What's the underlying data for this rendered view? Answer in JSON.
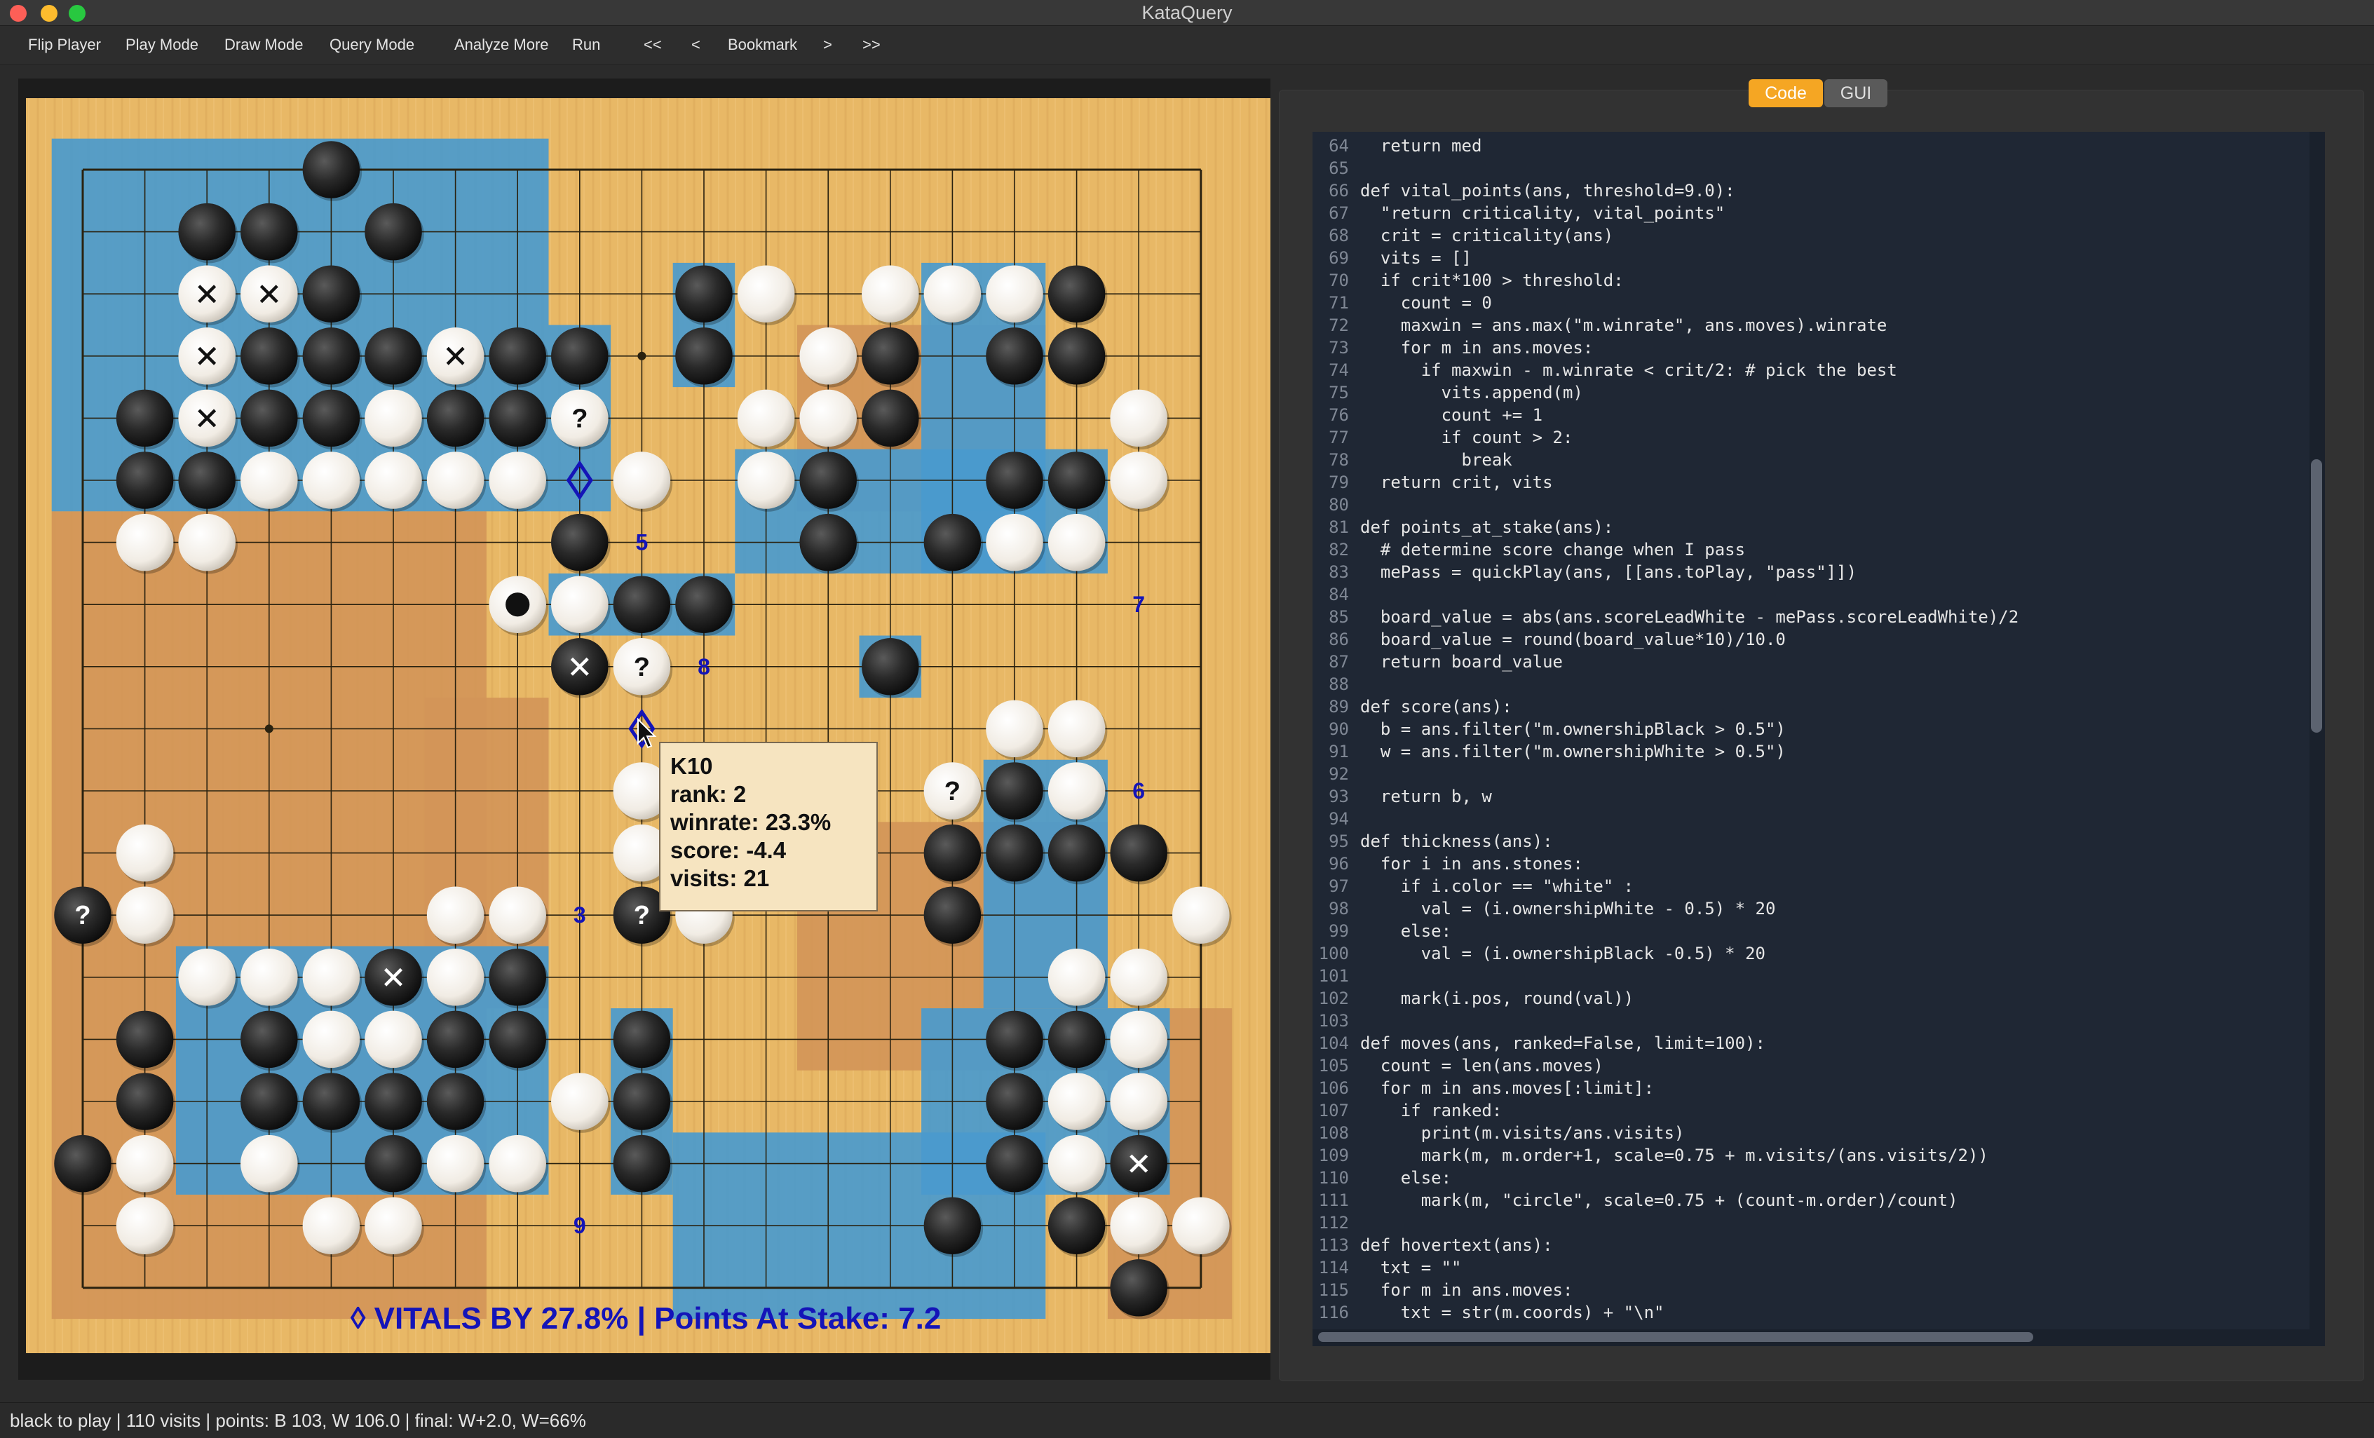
{
  "window": {
    "title": "KataQuery",
    "buttons": [
      "close",
      "minimize",
      "zoom"
    ],
    "colors": {
      "close": "#fe5f57",
      "minimize": "#febc2e",
      "zoom": "#28c840"
    }
  },
  "toolbar": {
    "items": [
      "Flip Player",
      "Play Mode",
      "Draw Mode",
      "Query Mode",
      "Analyze More",
      "Run",
      "<<",
      "<",
      "Bookmark",
      ">",
      ">>"
    ]
  },
  "board": {
    "size": 19,
    "columns": "ABCDEFGHJKLMNOPQRST",
    "colors": {
      "wood": "#e8b866",
      "blue_territory": "#4a9acd",
      "orange_territory": "#d39558",
      "marker": "#1414b8"
    },
    "blue_regions": [
      {
        "cols": [
          0,
          7
        ],
        "rows": [
          0,
          2
        ]
      },
      {
        "cols": [
          0,
          8
        ],
        "rows": [
          3,
          5
        ]
      },
      {
        "cols": [
          10,
          10
        ],
        "rows": [
          2,
          3
        ]
      },
      {
        "cols": [
          14,
          15
        ],
        "rows": [
          2,
          6
        ]
      },
      {
        "cols": [
          11,
          16
        ],
        "rows": [
          5,
          6
        ]
      },
      {
        "cols": [
          15,
          16
        ],
        "rows": [
          10,
          13
        ]
      },
      {
        "cols": [
          2,
          7
        ],
        "rows": [
          13,
          16
        ]
      },
      {
        "cols": [
          9,
          9
        ],
        "rows": [
          14,
          16
        ]
      },
      {
        "cols": [
          10,
          15
        ],
        "rows": [
          16,
          18
        ]
      },
      {
        "cols": [
          14,
          17
        ],
        "rows": [
          14,
          16
        ]
      },
      {
        "cols": [
          8,
          10
        ],
        "rows": [
          7,
          7
        ]
      },
      {
        "cols": [
          13,
          13
        ],
        "rows": [
          8,
          8
        ]
      }
    ],
    "orange_regions": [
      {
        "cols": [
          0,
          6
        ],
        "rows": [
          6,
          18
        ]
      },
      {
        "cols": [
          6,
          7
        ],
        "rows": [
          9,
          13
        ]
      },
      {
        "cols": [
          12,
          16
        ],
        "rows": [
          11,
          14
        ]
      },
      {
        "cols": [
          17,
          18
        ],
        "rows": [
          14,
          18
        ]
      },
      {
        "cols": [
          12,
          15
        ],
        "rows": [
          3,
          5
        ]
      }
    ],
    "stones": [
      {
        "c": 4,
        "r": 0,
        "color": "B"
      },
      {
        "c": 2,
        "r": 1,
        "color": "B"
      },
      {
        "c": 3,
        "r": 1,
        "color": "B"
      },
      {
        "c": 5,
        "r": 1,
        "color": "B"
      },
      {
        "c": 2,
        "r": 2,
        "color": "W",
        "mark": "x"
      },
      {
        "c": 3,
        "r": 2,
        "color": "W",
        "mark": "x"
      },
      {
        "c": 4,
        "r": 2,
        "color": "B"
      },
      {
        "c": 10,
        "r": 2,
        "color": "B"
      },
      {
        "c": 11,
        "r": 2,
        "color": "W"
      },
      {
        "c": 13,
        "r": 2,
        "color": "W"
      },
      {
        "c": 14,
        "r": 2,
        "color": "W"
      },
      {
        "c": 15,
        "r": 2,
        "color": "W"
      },
      {
        "c": 16,
        "r": 2,
        "color": "B"
      },
      {
        "c": 2,
        "r": 3,
        "color": "W",
        "mark": "x"
      },
      {
        "c": 3,
        "r": 3,
        "color": "B"
      },
      {
        "c": 4,
        "r": 3,
        "color": "B"
      },
      {
        "c": 5,
        "r": 3,
        "color": "B"
      },
      {
        "c": 6,
        "r": 3,
        "color": "W",
        "mark": "x"
      },
      {
        "c": 7,
        "r": 3,
        "color": "B"
      },
      {
        "c": 8,
        "r": 3,
        "color": "B"
      },
      {
        "c": 10,
        "r": 3,
        "color": "B"
      },
      {
        "c": 12,
        "r": 3,
        "color": "W"
      },
      {
        "c": 13,
        "r": 3,
        "color": "B"
      },
      {
        "c": 15,
        "r": 3,
        "color": "B"
      },
      {
        "c": 16,
        "r": 3,
        "color": "B"
      },
      {
        "c": 1,
        "r": 4,
        "color": "B"
      },
      {
        "c": 2,
        "r": 4,
        "color": "W",
        "mark": "x"
      },
      {
        "c": 3,
        "r": 4,
        "color": "B"
      },
      {
        "c": 4,
        "r": 4,
        "color": "B"
      },
      {
        "c": 5,
        "r": 4,
        "color": "W"
      },
      {
        "c": 6,
        "r": 4,
        "color": "B"
      },
      {
        "c": 7,
        "r": 4,
        "color": "B"
      },
      {
        "c": 8,
        "r": 4,
        "color": "W",
        "mark": "?"
      },
      {
        "c": 11,
        "r": 4,
        "color": "W"
      },
      {
        "c": 12,
        "r": 4,
        "color": "W"
      },
      {
        "c": 13,
        "r": 4,
        "color": "B"
      },
      {
        "c": 17,
        "r": 4,
        "color": "W"
      },
      {
        "c": 1,
        "r": 5,
        "color": "B"
      },
      {
        "c": 2,
        "r": 5,
        "color": "B"
      },
      {
        "c": 3,
        "r": 5,
        "color": "W"
      },
      {
        "c": 4,
        "r": 5,
        "color": "W"
      },
      {
        "c": 5,
        "r": 5,
        "color": "W"
      },
      {
        "c": 6,
        "r": 5,
        "color": "W"
      },
      {
        "c": 7,
        "r": 5,
        "color": "W"
      },
      {
        "c": 9,
        "r": 5,
        "color": "W"
      },
      {
        "c": 11,
        "r": 5,
        "color": "W"
      },
      {
        "c": 12,
        "r": 5,
        "color": "B"
      },
      {
        "c": 15,
        "r": 5,
        "color": "B"
      },
      {
        "c": 16,
        "r": 5,
        "color": "B"
      },
      {
        "c": 17,
        "r": 5,
        "color": "W"
      },
      {
        "c": 1,
        "r": 6,
        "color": "W"
      },
      {
        "c": 2,
        "r": 6,
        "color": "W"
      },
      {
        "c": 8,
        "r": 6,
        "color": "B"
      },
      {
        "c": 12,
        "r": 6,
        "color": "B"
      },
      {
        "c": 14,
        "r": 6,
        "color": "B"
      },
      {
        "c": 15,
        "r": 6,
        "color": "W"
      },
      {
        "c": 16,
        "r": 6,
        "color": "W"
      },
      {
        "c": 7,
        "r": 7,
        "color": "W",
        "mark": "dot"
      },
      {
        "c": 8,
        "r": 7,
        "color": "W"
      },
      {
        "c": 9,
        "r": 7,
        "color": "B"
      },
      {
        "c": 10,
        "r": 7,
        "color": "B"
      },
      {
        "c": 8,
        "r": 8,
        "color": "B",
        "mark": "x"
      },
      {
        "c": 9,
        "r": 8,
        "color": "W",
        "mark": "?"
      },
      {
        "c": 13,
        "r": 8,
        "color": "B"
      },
      {
        "c": 15,
        "r": 9,
        "color": "W"
      },
      {
        "c": 16,
        "r": 9,
        "color": "W"
      },
      {
        "c": 9,
        "r": 10,
        "color": "W"
      },
      {
        "c": 14,
        "r": 10,
        "color": "W",
        "mark": "?"
      },
      {
        "c": 15,
        "r": 10,
        "color": "B"
      },
      {
        "c": 16,
        "r": 10,
        "color": "W"
      },
      {
        "c": 1,
        "r": 11,
        "color": "W"
      },
      {
        "c": 9,
        "r": 11,
        "color": "W"
      },
      {
        "c": 14,
        "r": 11,
        "color": "B"
      },
      {
        "c": 15,
        "r": 11,
        "color": "B"
      },
      {
        "c": 16,
        "r": 11,
        "color": "B"
      },
      {
        "c": 17,
        "r": 11,
        "color": "B"
      },
      {
        "c": 0,
        "r": 12,
        "color": "B",
        "mark": "?"
      },
      {
        "c": 1,
        "r": 12,
        "color": "W"
      },
      {
        "c": 6,
        "r": 12,
        "color": "W"
      },
      {
        "c": 7,
        "r": 12,
        "color": "W"
      },
      {
        "c": 9,
        "r": 12,
        "color": "B",
        "mark": "?"
      },
      {
        "c": 10,
        "r": 12,
        "color": "W"
      },
      {
        "c": 14,
        "r": 12,
        "color": "B"
      },
      {
        "c": 18,
        "r": 12,
        "color": "W"
      },
      {
        "c": 2,
        "r": 13,
        "color": "W"
      },
      {
        "c": 3,
        "r": 13,
        "color": "W"
      },
      {
        "c": 4,
        "r": 13,
        "color": "W"
      },
      {
        "c": 5,
        "r": 13,
        "color": "B",
        "mark": "x"
      },
      {
        "c": 6,
        "r": 13,
        "color": "W"
      },
      {
        "c": 7,
        "r": 13,
        "color": "B"
      },
      {
        "c": 16,
        "r": 13,
        "color": "W"
      },
      {
        "c": 17,
        "r": 13,
        "color": "W"
      },
      {
        "c": 1,
        "r": 14,
        "color": "B"
      },
      {
        "c": 3,
        "r": 14,
        "color": "B"
      },
      {
        "c": 4,
        "r": 14,
        "color": "W"
      },
      {
        "c": 5,
        "r": 14,
        "color": "W"
      },
      {
        "c": 6,
        "r": 14,
        "color": "B"
      },
      {
        "c": 7,
        "r": 14,
        "color": "B"
      },
      {
        "c": 9,
        "r": 14,
        "color": "B"
      },
      {
        "c": 15,
        "r": 14,
        "color": "B"
      },
      {
        "c": 16,
        "r": 14,
        "color": "B"
      },
      {
        "c": 17,
        "r": 14,
        "color": "W"
      },
      {
        "c": 1,
        "r": 15,
        "color": "B"
      },
      {
        "c": 3,
        "r": 15,
        "color": "B"
      },
      {
        "c": 4,
        "r": 15,
        "color": "B"
      },
      {
        "c": 5,
        "r": 15,
        "color": "B"
      },
      {
        "c": 6,
        "r": 15,
        "color": "B"
      },
      {
        "c": 8,
        "r": 15,
        "color": "W"
      },
      {
        "c": 9,
        "r": 15,
        "color": "B"
      },
      {
        "c": 15,
        "r": 15,
        "color": "B"
      },
      {
        "c": 16,
        "r": 15,
        "color": "W"
      },
      {
        "c": 17,
        "r": 15,
        "color": "W"
      },
      {
        "c": 0,
        "r": 16,
        "color": "B"
      },
      {
        "c": 1,
        "r": 16,
        "color": "W"
      },
      {
        "c": 3,
        "r": 16,
        "color": "W"
      },
      {
        "c": 5,
        "r": 16,
        "color": "B"
      },
      {
        "c": 6,
        "r": 16,
        "color": "W"
      },
      {
        "c": 7,
        "r": 16,
        "color": "W"
      },
      {
        "c": 9,
        "r": 16,
        "color": "B"
      },
      {
        "c": 15,
        "r": 16,
        "color": "B"
      },
      {
        "c": 16,
        "r": 16,
        "color": "W"
      },
      {
        "c": 17,
        "r": 16,
        "color": "B",
        "mark": "x"
      },
      {
        "c": 1,
        "r": 17,
        "color": "W"
      },
      {
        "c": 4,
        "r": 17,
        "color": "W"
      },
      {
        "c": 5,
        "r": 17,
        "color": "W"
      },
      {
        "c": 14,
        "r": 17,
        "color": "B"
      },
      {
        "c": 16,
        "r": 17,
        "color": "B"
      },
      {
        "c": 17,
        "r": 17,
        "color": "W"
      },
      {
        "c": 18,
        "r": 17,
        "color": "W"
      },
      {
        "c": 17,
        "r": 18,
        "color": "B"
      }
    ],
    "star_points": [
      {
        "c": 9,
        "r": 3
      },
      {
        "c": 3,
        "r": 9
      }
    ],
    "numbers": [
      {
        "c": 9,
        "r": 6,
        "text": "5"
      },
      {
        "c": 17,
        "r": 7,
        "text": "7"
      },
      {
        "c": 10,
        "r": 8,
        "text": "8"
      },
      {
        "c": 17,
        "r": 10,
        "text": "6"
      },
      {
        "c": 8,
        "r": 12,
        "text": "3"
      },
      {
        "c": 8,
        "r": 17,
        "text": "9"
      }
    ],
    "vital_diamonds": [
      {
        "c": 8,
        "r": 5
      },
      {
        "c": 9,
        "r": 9
      }
    ],
    "footer_text": "◊ VITALS BY 27.8% | Points At Stake: 7.2"
  },
  "tooltip": {
    "coord": "K10",
    "rank": "rank: 2",
    "winrate": "winrate: 23.3%",
    "score": "score:  -4.4",
    "visits": "visits:  21"
  },
  "tabs": {
    "code": "Code",
    "gui": "GUI",
    "active": "Code",
    "active_color": "#f5a623"
  },
  "code": {
    "lines": [
      {
        "n": "64",
        "t": "  return med"
      },
      {
        "n": "65",
        "t": ""
      },
      {
        "n": "66",
        "t": "def vital_points(ans, threshold=9.0):"
      },
      {
        "n": "67",
        "t": "  \"return criticality, vital_points\""
      },
      {
        "n": "68",
        "t": "  crit = criticality(ans)"
      },
      {
        "n": "69",
        "t": "  vits = []"
      },
      {
        "n": "70",
        "t": "  if crit*100 > threshold:"
      },
      {
        "n": "71",
        "t": "    count = 0"
      },
      {
        "n": "72",
        "t": "    maxwin = ans.max(\"m.winrate\", ans.moves).winrate"
      },
      {
        "n": "73",
        "t": "    for m in ans.moves:"
      },
      {
        "n": "74",
        "t": "      if maxwin - m.winrate < crit/2: # pick the best"
      },
      {
        "n": "75",
        "t": "        vits.append(m)"
      },
      {
        "n": "76",
        "t": "        count += 1"
      },
      {
        "n": "77",
        "t": "        if count > 2:"
      },
      {
        "n": "78",
        "t": "          break"
      },
      {
        "n": "79",
        "t": "  return crit, vits"
      },
      {
        "n": "80",
        "t": ""
      },
      {
        "n": "81",
        "t": "def points_at_stake(ans):"
      },
      {
        "n": "82",
        "t": "  # determine score change when I pass"
      },
      {
        "n": "83",
        "t": "  mePass = quickPlay(ans, [[ans.toPlay, \"pass\"]])"
      },
      {
        "n": "84",
        "t": ""
      },
      {
        "n": "85",
        "t": "  board_value = abs(ans.scoreLeadWhite - mePass.scoreLeadWhite)/2"
      },
      {
        "n": "86",
        "t": "  board_value = round(board_value*10)/10.0"
      },
      {
        "n": "87",
        "t": "  return board_value"
      },
      {
        "n": "88",
        "t": ""
      },
      {
        "n": "89",
        "t": "def score(ans):"
      },
      {
        "n": "90",
        "t": "  b = ans.filter(\"m.ownershipBlack > 0.5\")"
      },
      {
        "n": "91",
        "t": "  w = ans.filter(\"m.ownershipWhite > 0.5\")"
      },
      {
        "n": "92",
        "t": ""
      },
      {
        "n": "93",
        "t": "  return b, w"
      },
      {
        "n": "94",
        "t": ""
      },
      {
        "n": "95",
        "t": "def thickness(ans):"
      },
      {
        "n": "96",
        "t": "  for i in ans.stones:"
      },
      {
        "n": "97",
        "t": "    if i.color == \"white\" :"
      },
      {
        "n": "98",
        "t": "      val = (i.ownershipWhite - 0.5) * 20"
      },
      {
        "n": "99",
        "t": "    else:"
      },
      {
        "n": "100",
        "t": "      val = (i.ownershipBlack -0.5) * 20"
      },
      {
        "n": "101",
        "t": ""
      },
      {
        "n": "102",
        "t": "    mark(i.pos, round(val))"
      },
      {
        "n": "103",
        "t": ""
      },
      {
        "n": "104",
        "t": "def moves(ans, ranked=False, limit=100):"
      },
      {
        "n": "105",
        "t": "  count = len(ans.moves)"
      },
      {
        "n": "106",
        "t": "  for m in ans.moves[:limit]:"
      },
      {
        "n": "107",
        "t": "    if ranked:"
      },
      {
        "n": "108",
        "t": "      print(m.visits/ans.visits)"
      },
      {
        "n": "109",
        "t": "      mark(m, m.order+1, scale=0.75 + m.visits/(ans.visits/2))"
      },
      {
        "n": "110",
        "t": "    else:"
      },
      {
        "n": "111",
        "t": "      mark(m, \"circle\", scale=0.75 + (count-m.order)/count)"
      },
      {
        "n": "112",
        "t": ""
      },
      {
        "n": "113",
        "t": "def hovertext(ans):"
      },
      {
        "n": "114",
        "t": "  txt = \"\""
      },
      {
        "n": "115",
        "t": "  for m in ans.moves:"
      },
      {
        "n": "116",
        "t": "    txt = str(m.coords) + \"\\n\""
      }
    ],
    "colors": {
      "background": "#1f2734",
      "text": "#e6e6e6",
      "line_number": "#7f8794"
    }
  },
  "status": {
    "text": "black to play | 110 visits | points: B 103, W 106.0 | final: W+2.0, W=66%"
  }
}
